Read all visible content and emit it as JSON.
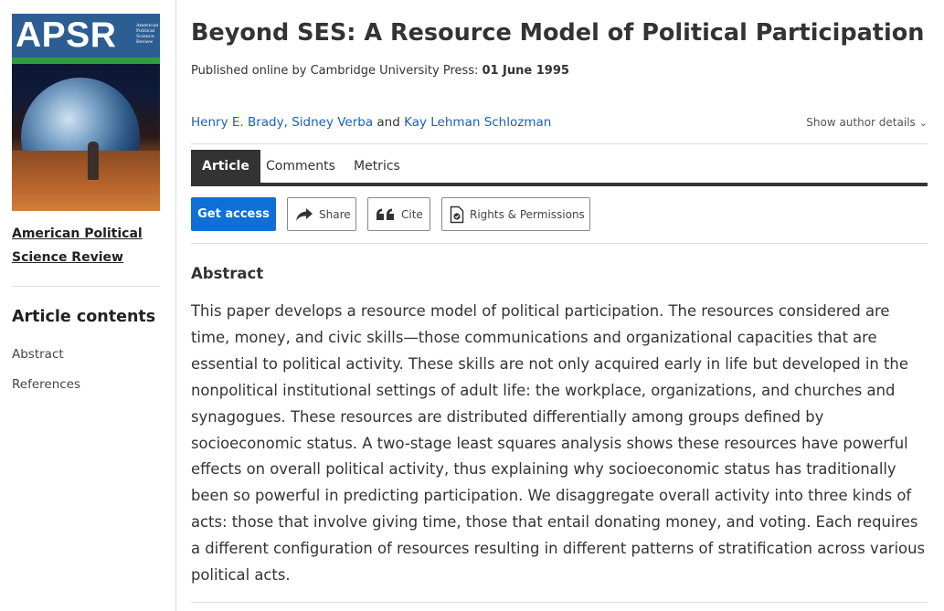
{
  "sidebar": {
    "cover": {
      "logo_text": "APSR",
      "journal_tiny": "American Political Science Review"
    },
    "journal_link": "American Political Science Review",
    "contents_title": "Article contents",
    "links": [
      "Abstract",
      "References"
    ]
  },
  "article": {
    "title": "Beyond SES: A Resource Model of Political Participation",
    "published_prefix": "Published online by Cambridge University Press:",
    "published_date": "01 June 1995",
    "authors": [
      "Henry E. Brady,",
      "Sidney Verba",
      "and",
      "Kay Lehman Schlozman"
    ],
    "show_author_details": "Show author details"
  },
  "tabs": [
    "Article",
    "Comments",
    "Metrics"
  ],
  "actions": {
    "get_access": "Get access",
    "share": "Share",
    "cite": "Cite",
    "rights": "Rights & Permissions"
  },
  "abstract": {
    "heading": "Abstract",
    "text": "This paper develops a resource model of political participation. The resources considered are time, money, and civic skills—those communications and organizational capacities that are essential to political activity. These skills are not only acquired early in life but developed in the nonpolitical institutional settings of adult life: the workplace, organizations, and churches and synagogues. These resources are distributed differentially among groups defined by socioeconomic status. A two-stage least squares analysis shows these resources have powerful effects on overall political activity, thus explaining why socioeconomic status has traditionally been so powerful in predicting participation. We disaggregate overall activity into three kinds of acts: those that involve giving time, those that entail donating money, and voting. Each requires a different configuration of resources resulting in different patterns of stratification across various political acts."
  },
  "colors": {
    "link": "#1c5fb4",
    "primary_button": "#0f6fd6",
    "cover_masthead": "#2c5e93",
    "cover_stripe": "#2e9e3e"
  },
  "icons": [
    "share-arrow-icon",
    "quote-icon",
    "document-check-icon",
    "chevron-down-icon"
  ]
}
